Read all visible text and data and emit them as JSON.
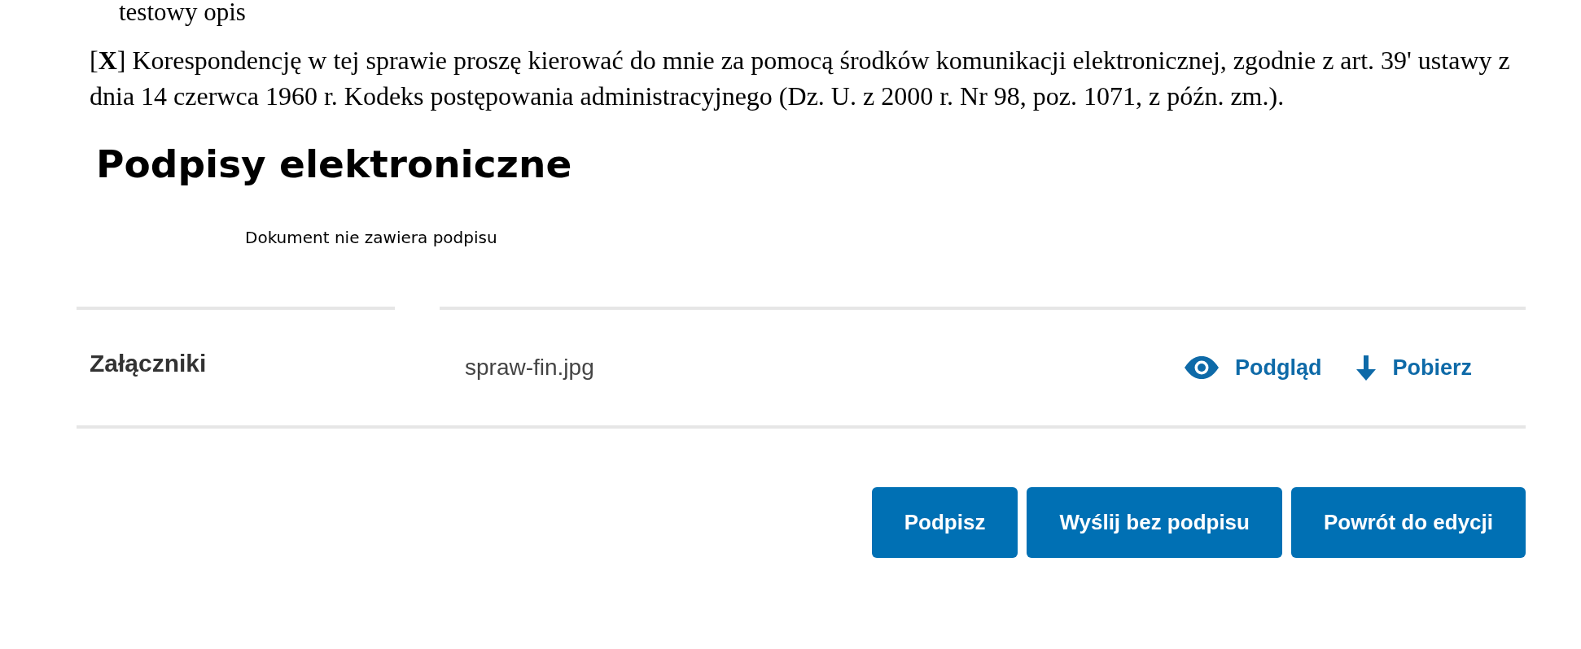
{
  "description": "testowy opis",
  "consent": "[**X**] Korespondencję w tej sprawie proszę kierować do mnie za pomocą środków komunikacji elektronicznej, zgodnie z art. 39' ustawy z dnia 14 czerwca 1960 r. Kodeks postępowania administracyjnego (Dz. U. z 2000 r. Nr 98, poz. 1071, z późn. zm.).",
  "signatures": {
    "title": "Podpisy elektroniczne",
    "status": "Dokument nie zawiera podpisu"
  },
  "attachments": {
    "label": "Załączniki",
    "files": [
      {
        "name": "spraw-fin.jpg",
        "actions": [
          {
            "kind": "preview",
            "label": "Podgląd"
          },
          {
            "kind": "download",
            "label": "Pobierz"
          }
        ]
      }
    ]
  },
  "buttons": [
    {
      "label": "Podpisz"
    },
    {
      "label": "Wyślij bez podpisu"
    },
    {
      "label": "Powrót do edycji"
    }
  ]
}
